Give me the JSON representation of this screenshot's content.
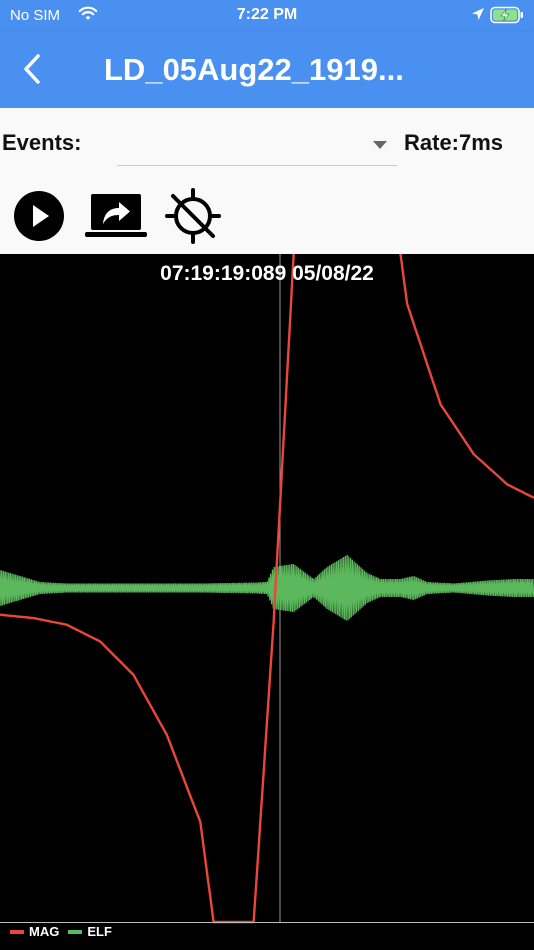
{
  "status_bar": {
    "carrier": "No SIM",
    "time": "7:22 PM"
  },
  "nav": {
    "title": "LD_05Aug22_1919..."
  },
  "controls": {
    "events_label": "Events:",
    "events_value": "",
    "rate_label": "Rate:7ms"
  },
  "icons": [
    "back-chevron-icon",
    "play-icon",
    "export-to-screen-icon",
    "reset-location-icon"
  ],
  "colors": {
    "header": "#4a90f0",
    "mag": "#e8473a",
    "elf": "#5cb85c",
    "chart_bg": "#000000"
  },
  "chart": {
    "timestamp": "07:19:19:089 05/08/22"
  },
  "chart_data": {
    "type": "line",
    "legend": [
      "MAG",
      "ELF"
    ],
    "legend_position": "bottom-left",
    "grid": false,
    "cursor": true,
    "series": [
      {
        "name": "MAG",
        "color": "#e8473a",
        "points": [
          [
            0,
            -0.08
          ],
          [
            5,
            -0.09
          ],
          [
            10,
            -0.11
          ],
          [
            15,
            -0.16
          ],
          [
            20,
            -0.26
          ],
          [
            25,
            -0.44
          ],
          [
            30,
            -0.7
          ],
          [
            32,
            -1.0
          ],
          [
            38,
            -1.0
          ],
          [
            41,
            -0.1
          ],
          [
            44,
            1.0
          ],
          [
            44.5,
            1.3
          ]
        ]
      },
      {
        "name": "MAG",
        "color": "#e8473a",
        "points": [
          [
            58,
            1.3
          ],
          [
            61,
            0.85
          ],
          [
            66,
            0.55
          ],
          [
            71,
            0.4
          ],
          [
            76,
            0.31
          ],
          [
            80,
            0.27
          ]
        ]
      },
      {
        "name": "ELF",
        "color": "#5cb85c",
        "envelope": [
          [
            0,
            0.06
          ],
          [
            3,
            0.04
          ],
          [
            6,
            0.02
          ],
          [
            10,
            0.015
          ],
          [
            20,
            0.015
          ],
          [
            30,
            0.015
          ],
          [
            38,
            0.018
          ],
          [
            40,
            0.02
          ],
          [
            41,
            0.07
          ],
          [
            44,
            0.08
          ],
          [
            47,
            0.03
          ],
          [
            49,
            0.07
          ],
          [
            52,
            0.11
          ],
          [
            55,
            0.05
          ],
          [
            57,
            0.03
          ],
          [
            60,
            0.03
          ],
          [
            62,
            0.04
          ],
          [
            64,
            0.02
          ],
          [
            68,
            0.015
          ],
          [
            73,
            0.025
          ],
          [
            77,
            0.03
          ],
          [
            80,
            0.03
          ]
        ]
      }
    ]
  }
}
